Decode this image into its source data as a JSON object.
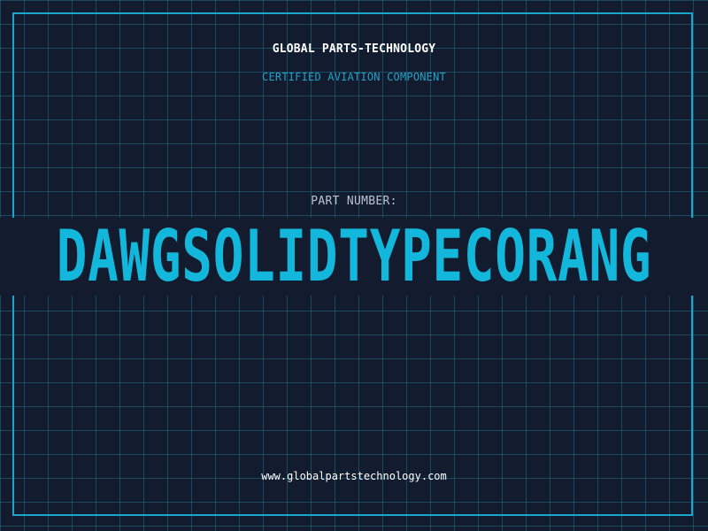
{
  "header": {
    "company": "GLOBAL PARTS-TECHNOLOGY",
    "tagline": "CERTIFIED AVIATION COMPONENT"
  },
  "part": {
    "label": "PART NUMBER:",
    "value": "DAWGSOLIDTYPECORANG"
  },
  "footer": {
    "website": "www.globalpartstechnology.com"
  },
  "colors": {
    "background": "#131b2e",
    "grid": "#20708a",
    "accent": "#1aa6cc",
    "part_number": "#14b7dc"
  }
}
